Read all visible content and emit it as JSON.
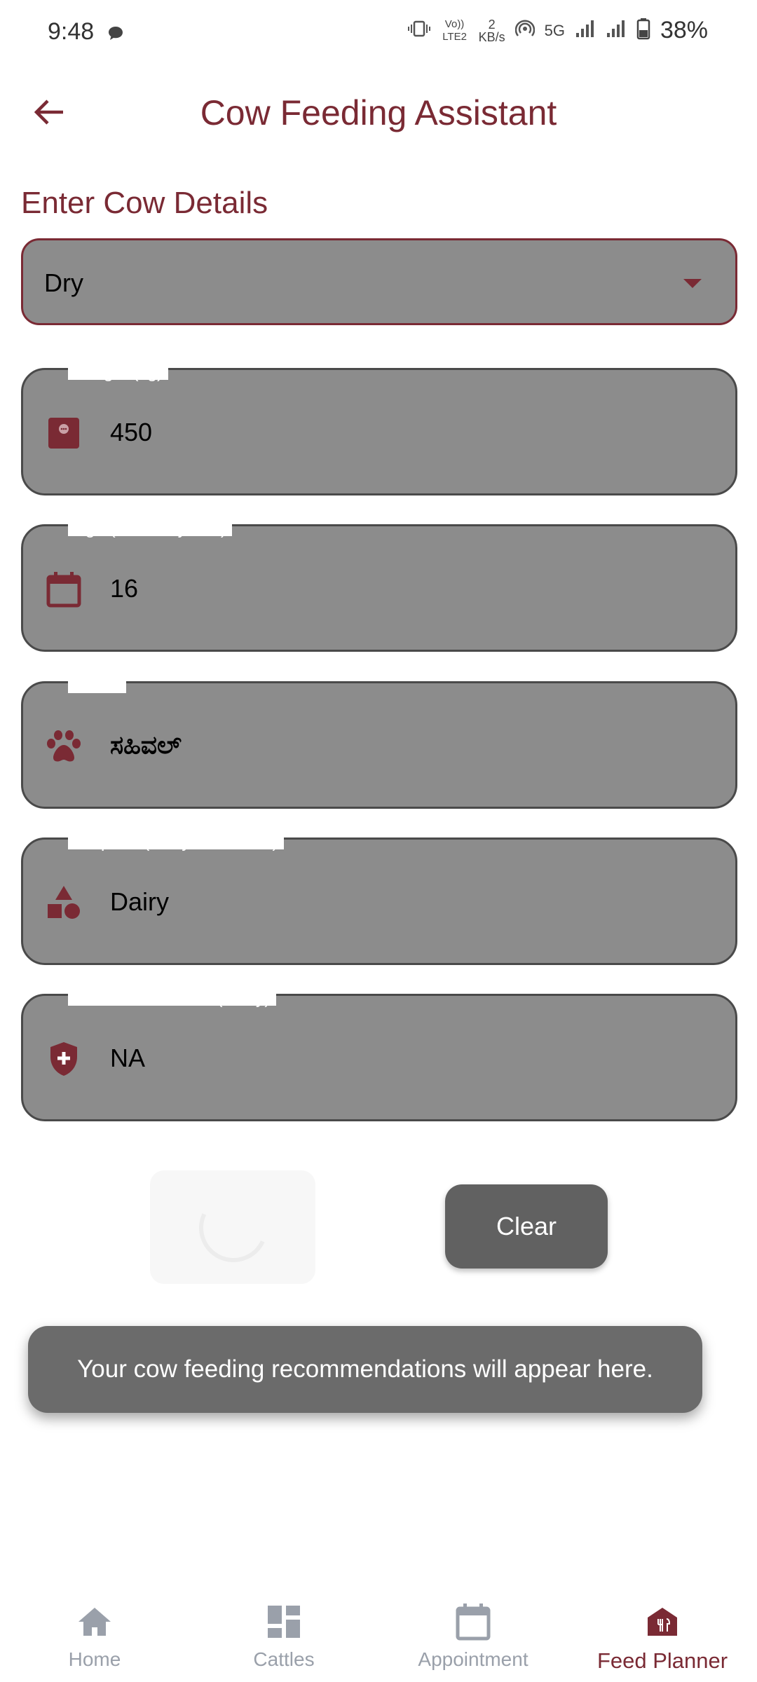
{
  "status_bar": {
    "time": "9:48",
    "volte": "Vo)) LTE2",
    "speed_value": "2",
    "speed_unit": "KB/s",
    "network": "5G",
    "battery": "38%"
  },
  "app_bar": {
    "title": "Cow Feeding Assistant"
  },
  "section_title": "Enter Cow Details",
  "dropdown": {
    "value": "Dry"
  },
  "fields": {
    "weight": {
      "label": "Weight (kg)",
      "value": "450",
      "icon": "scale-icon"
    },
    "age": {
      "label": "Age (months/years)",
      "value": "16",
      "icon": "calendar-icon"
    },
    "breed": {
      "label": "Breed",
      "value": "ಸಹಿವಲ್",
      "icon": "paw-icon"
    },
    "purpose": {
      "label": "Purpose (Dairy/Beef/Dual)",
      "value": "Dairy",
      "icon": "shapes-icon"
    },
    "health": {
      "label": "Health Conditions (if any)",
      "value": "NA",
      "icon": "shield-plus-icon"
    }
  },
  "buttons": {
    "clear": "Clear"
  },
  "result_message": "Your cow feeding recommendations will appear here.",
  "bottom_nav": {
    "items": [
      {
        "label": "Home",
        "icon": "home-icon"
      },
      {
        "label": "Cattles",
        "icon": "dashboard-icon"
      },
      {
        "label": "Appointment",
        "icon": "calendar-icon"
      },
      {
        "label": "Feed Planner",
        "icon": "restaurant-icon",
        "active": true
      }
    ]
  },
  "colors": {
    "accent": "#7a2a34",
    "field_bg": "#8c8c8c",
    "nav_inactive": "#9aa0aa"
  }
}
